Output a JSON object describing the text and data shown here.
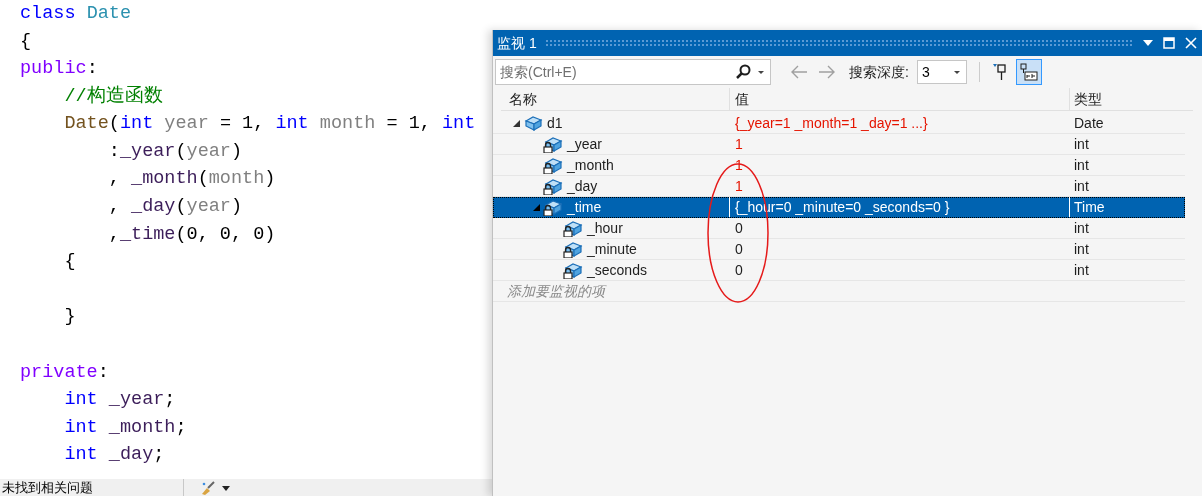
{
  "editor": {
    "lines": [
      {
        "tokens": [
          {
            "text": "class ",
            "kind": "keyword"
          },
          {
            "text": "Date",
            "kind": "type"
          }
        ]
      },
      {
        "tokens": [
          {
            "text": "{",
            "kind": "plain"
          }
        ]
      },
      {
        "tokens": [
          {
            "text": "public",
            "kind": "access"
          },
          {
            "text": ":",
            "kind": "plain"
          }
        ]
      },
      {
        "tokens": [
          {
            "text": "    //构造函数",
            "kind": "comment"
          }
        ]
      },
      {
        "tokens": [
          {
            "text": "    Date",
            "kind": "function"
          },
          {
            "text": "(",
            "kind": "plain"
          },
          {
            "text": "int ",
            "kind": "keyword"
          },
          {
            "text": "year",
            "kind": "param"
          },
          {
            "text": " = 1, ",
            "kind": "plain"
          },
          {
            "text": "int ",
            "kind": "keyword"
          },
          {
            "text": "month",
            "kind": "param"
          },
          {
            "text": " = 1, ",
            "kind": "plain"
          },
          {
            "text": "int",
            "kind": "keyword"
          }
        ]
      },
      {
        "tokens": [
          {
            "text": "        :",
            "kind": "plain"
          },
          {
            "text": "_year",
            "kind": "member"
          },
          {
            "text": "(",
            "kind": "plain"
          },
          {
            "text": "year",
            "kind": "param"
          },
          {
            "text": ")",
            "kind": "plain"
          }
        ]
      },
      {
        "tokens": [
          {
            "text": "        , ",
            "kind": "plain"
          },
          {
            "text": "_month",
            "kind": "member"
          },
          {
            "text": "(",
            "kind": "plain"
          },
          {
            "text": "month",
            "kind": "param"
          },
          {
            "text": ")",
            "kind": "plain"
          }
        ]
      },
      {
        "tokens": [
          {
            "text": "        , ",
            "kind": "plain"
          },
          {
            "text": "_day",
            "kind": "member"
          },
          {
            "text": "(",
            "kind": "plain"
          },
          {
            "text": "year",
            "kind": "param"
          },
          {
            "text": ")",
            "kind": "plain"
          }
        ]
      },
      {
        "tokens": [
          {
            "text": "        ,",
            "kind": "plain"
          },
          {
            "text": "_time",
            "kind": "member"
          },
          {
            "text": "(0, 0, 0)",
            "kind": "plain"
          }
        ]
      },
      {
        "tokens": [
          {
            "text": "    {",
            "kind": "plain"
          }
        ]
      },
      {
        "kind": "blank"
      },
      {
        "tokens": [
          {
            "text": "    }",
            "kind": "plain"
          }
        ]
      },
      {
        "kind": "blank"
      },
      {
        "tokens": [
          {
            "text": "private",
            "kind": "access"
          },
          {
            "text": ":",
            "kind": "plain"
          }
        ]
      },
      {
        "tokens": [
          {
            "text": "    int ",
            "kind": "keyword"
          },
          {
            "text": "_year",
            "kind": "member"
          },
          {
            "text": ";",
            "kind": "plain"
          }
        ]
      },
      {
        "tokens": [
          {
            "text": "    int ",
            "kind": "keyword"
          },
          {
            "text": "_month",
            "kind": "member"
          },
          {
            "text": ";",
            "kind": "plain"
          }
        ]
      },
      {
        "tokens": [
          {
            "text": "    int ",
            "kind": "keyword"
          },
          {
            "text": "_day",
            "kind": "member"
          },
          {
            "text": ";",
            "kind": "plain"
          }
        ]
      }
    ]
  },
  "status_bar": {
    "message": "未找到相关问题"
  },
  "watch": {
    "title": "监视 1",
    "search": {
      "placeholder": "搜索(Ctrl+E)"
    },
    "depth_label": "搜索深度:",
    "depth": "3",
    "columns": [
      "名称",
      "值",
      "类型"
    ],
    "rows": [
      {
        "name": "d1",
        "value": "{_year=1 _month=1 _day=1 ...}",
        "type": "Date",
        "kind": "variable",
        "changed": true,
        "expanded": true,
        "selected": false,
        "children": [
          {
            "name": "_year",
            "value": "1",
            "type": "int",
            "kind": "private_member",
            "changed": true,
            "selected": false
          },
          {
            "name": "_month",
            "value": "1",
            "type": "int",
            "kind": "private_member",
            "changed": true,
            "selected": false
          },
          {
            "name": "_day",
            "value": "1",
            "type": "int",
            "kind": "private_member",
            "changed": true,
            "selected": false
          },
          {
            "name": "_time",
            "value": "{_hour=0 _minute=0 _seconds=0 }",
            "type": "Time",
            "kind": "private_member",
            "changed": false,
            "expanded": true,
            "selected": true,
            "children": [
              {
                "name": "_hour",
                "value": "0",
                "type": "int",
                "kind": "private_member",
                "changed": false,
                "selected": false
              },
              {
                "name": "_minute",
                "value": "0",
                "type": "int",
                "kind": "private_member",
                "changed": false,
                "selected": false
              },
              {
                "name": "_seconds",
                "value": "0",
                "type": "int",
                "kind": "private_member",
                "changed": false,
                "selected": false
              }
            ]
          }
        ]
      }
    ],
    "add_placeholder": "添加要监视的项"
  }
}
